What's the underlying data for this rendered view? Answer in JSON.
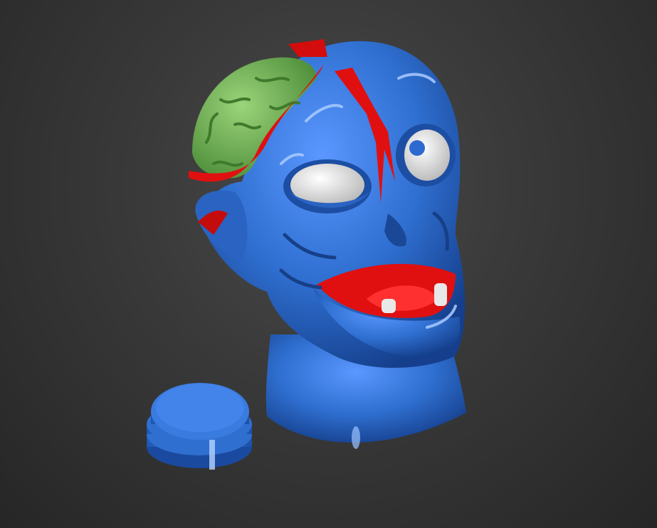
{
  "viewport": {
    "corner_label": "' '",
    "background_color": "#3a3a3a"
  },
  "scene": {
    "subject": "zombie-head-model",
    "object_colors": {
      "skin": "#2f6fd0",
      "brain": "#6aa84f",
      "blood": "#e01010",
      "eyes": "#f2f2f2",
      "teeth": "#e8e8e8"
    }
  }
}
